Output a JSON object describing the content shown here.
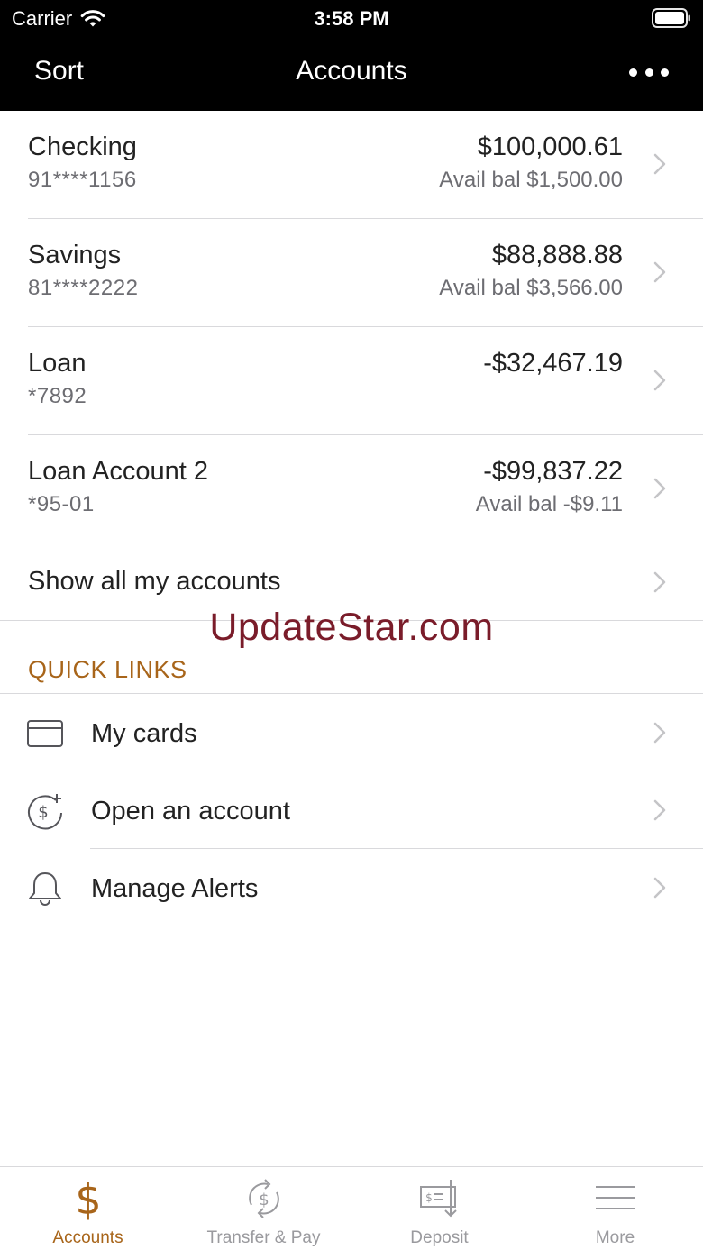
{
  "status_bar": {
    "carrier": "Carrier",
    "time": "3:58 PM"
  },
  "nav": {
    "sort_label": "Sort",
    "title": "Accounts",
    "more_icon": "ellipsis-icon"
  },
  "accounts": [
    {
      "name": "Checking",
      "number": "91****1156",
      "balance": "$100,000.61",
      "available": "Avail bal $1,500.00"
    },
    {
      "name": "Savings",
      "number": "81****2222",
      "balance": "$88,888.88",
      "available": "Avail bal $3,566.00"
    },
    {
      "name": "Loan",
      "number": "*7892",
      "balance": "-$32,467.19",
      "available": ""
    },
    {
      "name": "Loan Account 2",
      "number": "*95-01",
      "balance": "-$99,837.22",
      "available": "Avail bal -$9.11"
    }
  ],
  "show_all_label": "Show all my accounts",
  "watermark": "UpdateStar.com",
  "quick_links": {
    "header": "QUICK LINKS",
    "items": [
      {
        "label": "My cards",
        "icon": "credit-card-icon"
      },
      {
        "label": "Open an account",
        "icon": "dollar-plus-icon"
      },
      {
        "label": "Manage Alerts",
        "icon": "bell-icon"
      }
    ]
  },
  "tabs": [
    {
      "label": "Accounts",
      "icon": "dollar-icon",
      "active": true
    },
    {
      "label": "Transfer & Pay",
      "icon": "transfer-icon",
      "active": false
    },
    {
      "label": "Deposit",
      "icon": "check-deposit-icon",
      "active": false
    },
    {
      "label": "More",
      "icon": "menu-icon",
      "active": false
    }
  ],
  "colors": {
    "header_bg": "#000000",
    "accent": "#a8651a",
    "inactive_tab": "#9a9a9e",
    "watermark": "#7a1c2a"
  }
}
